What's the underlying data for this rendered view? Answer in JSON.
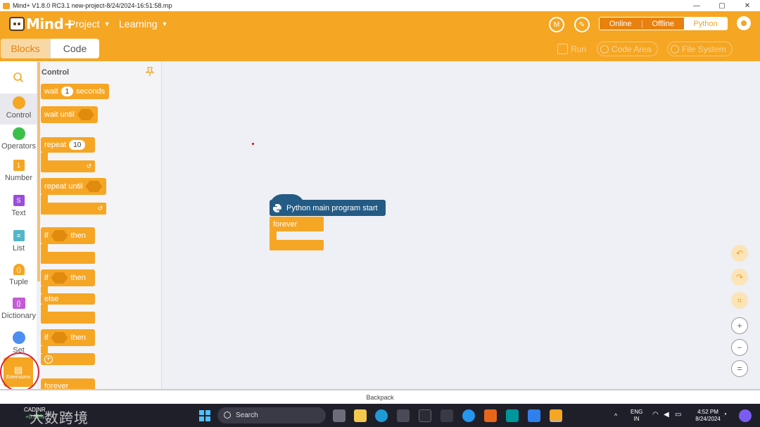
{
  "window": {
    "title": "Mind+ V1.8.0 RC3.1   new-project-8/24/2024-16:51:58.mp",
    "minimize": "—",
    "maximize": "▢",
    "close": "✕"
  },
  "header": {
    "logo_text": "Mind+",
    "menu_project": "Project",
    "menu_learning": "Learning",
    "caret": "▼",
    "modes": [
      "Online",
      "Offline",
      "Python"
    ],
    "active_mode": "Python"
  },
  "subbar": {
    "tab_blocks": "Blocks",
    "tab_code": "Code",
    "run": "Run",
    "code_area": "Code Area",
    "file_system": "File System"
  },
  "categories": [
    {
      "label": "Control",
      "color": "#f5a623"
    },
    {
      "label": "Operators",
      "color": "#3cbf4a"
    },
    {
      "label": "Number",
      "color": "#f5a623"
    },
    {
      "label": "Text",
      "color": "#9b4dd8"
    },
    {
      "label": "List",
      "color": "#52b6c9"
    },
    {
      "label": "Tuple",
      "color": "#f5a623"
    },
    {
      "label": "Dictionary",
      "color": "#c35bd6"
    },
    {
      "label": "Set",
      "color": "#4c8ff0"
    }
  ],
  "extensions_label": "Extensions",
  "palette": {
    "title": "Control",
    "wait": "wait",
    "wait_value": "1",
    "seconds": "seconds",
    "wait_until": "wait until",
    "repeat": "repeat",
    "repeat_value": "10",
    "repeat_until": "repeat until",
    "if": "if",
    "then": "then",
    "else": "else",
    "forever": "forever",
    "loop_arrow": "↺",
    "plus": "+"
  },
  "workspace": {
    "hat_label": "Python main program start",
    "forever_label": "forever"
  },
  "backpack": "Backpack",
  "taskbar": {
    "ticker": "CADINR",
    "ticker_change": "+0.69%",
    "watermark": "大数跨境",
    "search": "Search",
    "lang_top": "ENG",
    "lang_bottom": "IN",
    "time": "4:52 PM",
    "date": "8/24/2024"
  }
}
